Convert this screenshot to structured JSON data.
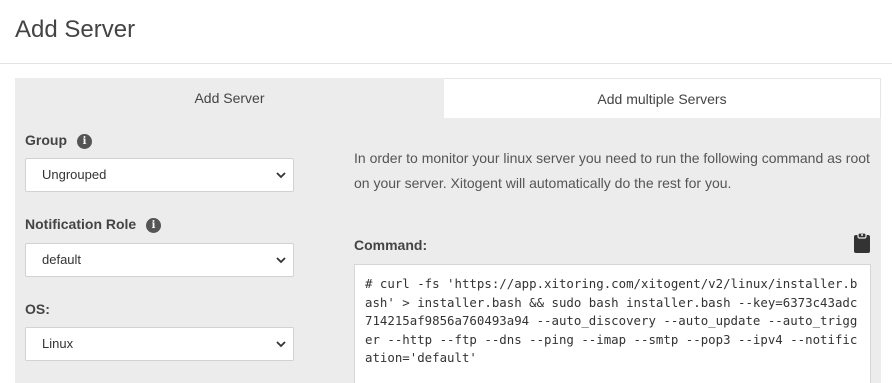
{
  "page": {
    "title": "Add Server"
  },
  "tabs": [
    {
      "label": "Add Server",
      "active": true
    },
    {
      "label": "Add multiple Servers",
      "active": false
    }
  ],
  "form": {
    "group": {
      "label": "Group",
      "value": "Ungrouped"
    },
    "notification_role": {
      "label": "Notification Role",
      "value": "default"
    },
    "os": {
      "label": "OS:",
      "value": "Linux"
    }
  },
  "instructions": {
    "description": "In order to monitor your linux server you need to run the following command as root on your server. Xitogent will automatically do the rest for you.",
    "command_label": "Command:",
    "command": "# curl -fs 'https://app.xitoring.com/xitogent/v2/linux/installer.bash' > installer.bash && sudo bash installer.bash --key=6373c43adc714215af9856a760493a94 --auto_discovery --auto_update --auto_trigger --http --ftp --dns --ping --imap --smtp --pop3 --ipv4 --notification='default'"
  },
  "icons": {
    "info": "info-icon",
    "clipboard": "clipboard-icon",
    "select_arrow": "chevron-down-icon"
  },
  "colors": {
    "panel_bg": "#ececec",
    "info_icon": "#555555"
  }
}
